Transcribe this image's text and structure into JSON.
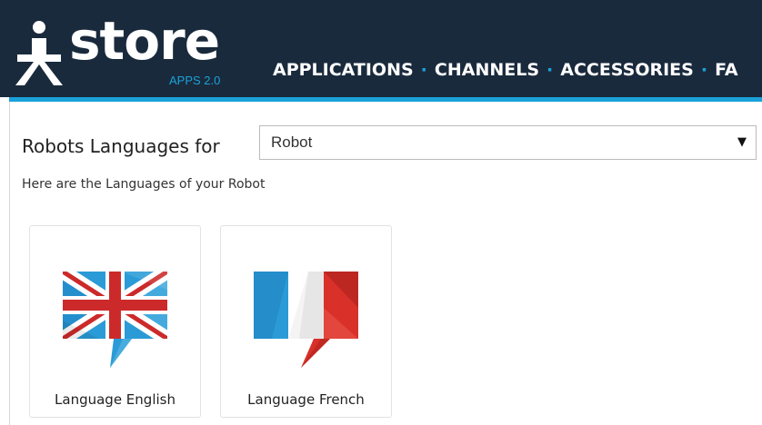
{
  "header": {
    "logo_text": "store",
    "logo_subtitle": "APPS 2.0",
    "nav": [
      {
        "label": "APPLICATIONS"
      },
      {
        "label": "CHANNELS"
      },
      {
        "label": "ACCESSORIES"
      },
      {
        "label": "FA"
      }
    ],
    "nav_separator": "·"
  },
  "main": {
    "label": "Robots Languages for",
    "select": {
      "value": "Robot",
      "arrow": "▼"
    },
    "subtitle": "Here are the Languages of your Robot",
    "cards": [
      {
        "label": "Language English",
        "flag": "uk-flag-icon"
      },
      {
        "label": "Language French",
        "flag": "fr-flag-icon"
      }
    ]
  },
  "colors": {
    "header_bg": "#1a2a3d",
    "accent": "#1aa2d8",
    "uk_red": "#cc2a2a",
    "fr_blue": "#2a9bd6",
    "fr_red": "#d9302a"
  }
}
